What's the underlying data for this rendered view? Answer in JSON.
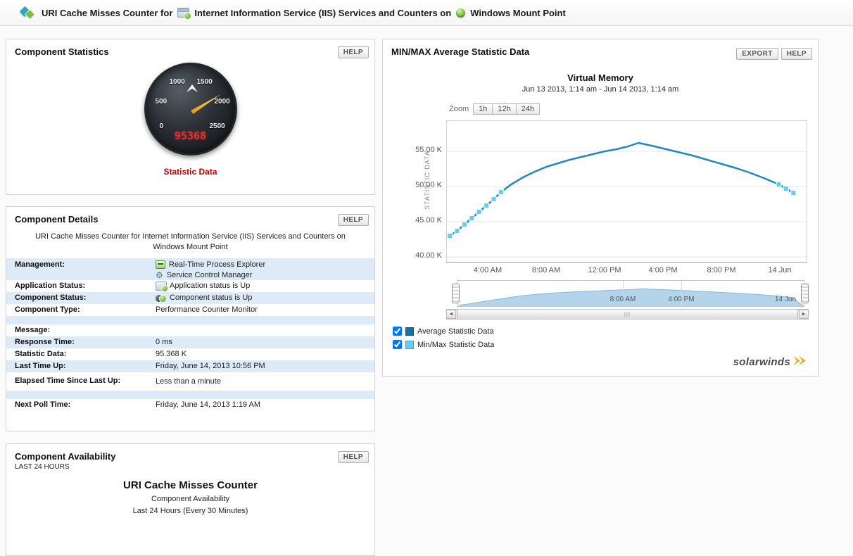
{
  "header": {
    "title_parts": [
      "URI Cache Misses Counter for",
      "Internet Information Service (IIS) Services and Counters on",
      "Windows Mount Point"
    ]
  },
  "stats_panel": {
    "title": "Component Statistics",
    "help": "HELP",
    "gauge_ticks": [
      "0",
      "500",
      "1000",
      "1500",
      "2000",
      "2500"
    ],
    "gauge_value": "95368",
    "gauge_label": "Statistic Data"
  },
  "details_panel": {
    "title": "Component Details",
    "help": "HELP",
    "subtitle": "URI Cache Misses Counter for Internet Information Service (IIS) Services and Counters on Windows Mount Point",
    "management_label": "Management:",
    "management_links": [
      "Real-Time Process Explorer",
      "Service Control Manager"
    ],
    "rows": [
      {
        "label": "Application Status:",
        "value": "Application status is Up"
      },
      {
        "label": "Component Status:",
        "value": "Component status is Up"
      },
      {
        "label": "Component Type:",
        "value": "Performance Counter Monitor"
      },
      {
        "label": "Message:",
        "value": ""
      },
      {
        "label": "Response Time:",
        "value": "0 ms"
      },
      {
        "label": "Statistic Data:",
        "value": "95.368 K"
      },
      {
        "label": "Last Time Up:",
        "value": "Friday, June 14, 2013 10:56 PM"
      },
      {
        "label": "Elapsed Time Since Last Up:",
        "value": "Less than a minute"
      },
      {
        "label": "Next Poll Time:",
        "value": "Friday, June 14, 2013 1:19 AM"
      }
    ]
  },
  "availability_panel": {
    "title": "Component Availability",
    "help": "HELP",
    "period": "LAST 24 HOURS",
    "chart_title": "URI Cache Misses Counter",
    "chart_sub1": "Component Availability",
    "chart_sub2": "Last 24 Hours (Every 30 Minutes)"
  },
  "minmax_panel": {
    "title": "MIN/MAX Average Statistic Data",
    "export": "EXPORT",
    "help": "HELP",
    "zoom_label": "Zoom",
    "zoom_options": [
      "1h",
      "12h",
      "24h"
    ],
    "legend": [
      {
        "label": "Average Statistic Data",
        "color": "#1d6f9e",
        "checked": true
      },
      {
        "label": "Min/Max Statistic Data",
        "color": "#66cdf0",
        "checked": true
      }
    ],
    "logo_text": "solarwinds"
  },
  "chart_data": {
    "type": "line",
    "title": "Virtual Memory",
    "subtitle": "Jun 13 2013, 1:14 am - Jun 14 2013, 1:14 am",
    "ylabel": "STATISTIC DATA",
    "unit": "K",
    "ylim": [
      39.3,
      59.3
    ],
    "xrange": [
      1.2,
      25.8
    ],
    "ytick_values": [
      55,
      50,
      45,
      40
    ],
    "yticks": [
      "55.00 K",
      "50.00 K",
      "45.00 K",
      "40.00 K"
    ],
    "xticks": [
      "4:00 AM",
      "8:00 AM",
      "12:00 PM",
      "4:00 PM",
      "8:00 PM",
      "14 Jun"
    ],
    "navigator_labels": [
      "8:00 AM",
      "4:00 PM",
      "14 Jun"
    ],
    "series": [
      {
        "name": "Average Statistic Data",
        "color": "#2387bd",
        "x": [
          1.4,
          1.9,
          2.4,
          2.9,
          3.4,
          3.9,
          4.4,
          4.9,
          5.6,
          6.4,
          7.2,
          8.0,
          8.8,
          9.6,
          10.4,
          11.2,
          12.0,
          12.8,
          13.6,
          14.3,
          15.2,
          16.0,
          17.0,
          18.0,
          19.0,
          20.0,
          21.0,
          22.0,
          23.0,
          23.9,
          24.4,
          24.9
        ],
        "y": [
          43.0,
          43.7,
          44.6,
          45.5,
          46.4,
          47.3,
          48.2,
          49.2,
          50.3,
          51.3,
          52.1,
          52.8,
          53.3,
          53.8,
          54.2,
          54.6,
          55.0,
          55.3,
          55.7,
          56.2,
          55.8,
          55.4,
          54.9,
          54.4,
          53.8,
          53.2,
          52.6,
          51.9,
          51.1,
          50.3,
          49.7,
          49.1
        ]
      },
      {
        "name": "Min/Max Statistic Data",
        "color": "#66cdf0",
        "x": [
          1.4,
          1.9,
          2.4,
          2.9,
          3.4,
          3.9,
          4.4,
          4.9,
          23.9,
          24.4,
          24.9
        ],
        "y": [
          43.0,
          43.7,
          44.6,
          45.5,
          46.4,
          47.3,
          48.2,
          49.2,
          50.3,
          49.7,
          49.1
        ]
      }
    ]
  }
}
